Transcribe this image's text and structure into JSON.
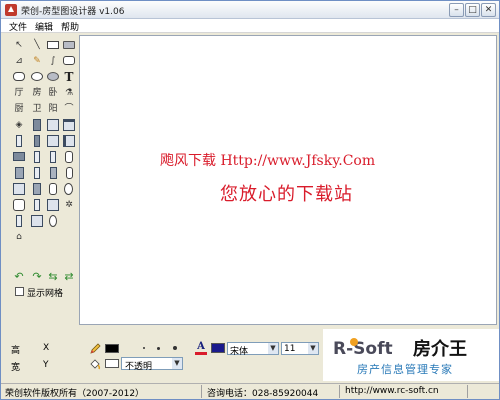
{
  "window": {
    "title": "荣创-房型图设计器 v1.06"
  },
  "title_buttons": {
    "minimize": "–",
    "maximize": "□",
    "close": "✕"
  },
  "menu": {
    "file": "文件",
    "edit": "编辑",
    "help": "帮助"
  },
  "toolbar": {
    "tool_chars": {
      "hall": "厅",
      "room": "房",
      "bedroom": "卧",
      "kitchen": "厨",
      "toilet": "卫",
      "corridor": "阳",
      "text": "T"
    },
    "icons": [
      "pointer-icon",
      "line-icon",
      "rectangle-icon",
      "rounded-rect-icon",
      "polygon-icon",
      "pencil-icon",
      "curve-icon",
      "round-rect-icon",
      "ellipse-icon",
      "rounded-fill-icon",
      "fill-shape-icon",
      "text-icon",
      "arc-icon",
      "wall-icon",
      "door-icon",
      "window-icon",
      "compass-icon",
      "home-icon",
      "undo-icon",
      "redo-icon",
      "group-icon",
      "ungroup-icon"
    ],
    "grid_label": "显示网格"
  },
  "watermark": {
    "line1": "飑风下载 Http://www.Jfsky.Com",
    "line2": "您放心的下载站"
  },
  "dimensions": {
    "height_label": "高",
    "x_label": "X",
    "width_label": "宽",
    "y_label": "Y"
  },
  "format": {
    "opacity": "不透明",
    "font": "宋体",
    "size": "11",
    "font_color_glyph": "A"
  },
  "colors": {
    "pen": "#000000",
    "fill": "#ffffff",
    "font": "#1a1a8c",
    "watermark": "#d91c2b",
    "logo_accent": "#f0a020"
  },
  "logo": {
    "brand": "R-Soft",
    "name": "房介王",
    "tagline": "房产信息管理专家"
  },
  "status": {
    "copyright": "荣创软件版权所有（2007-2012）",
    "phone": "咨询电话：028-85920044",
    "url": "http://www.rc-soft.cn"
  }
}
